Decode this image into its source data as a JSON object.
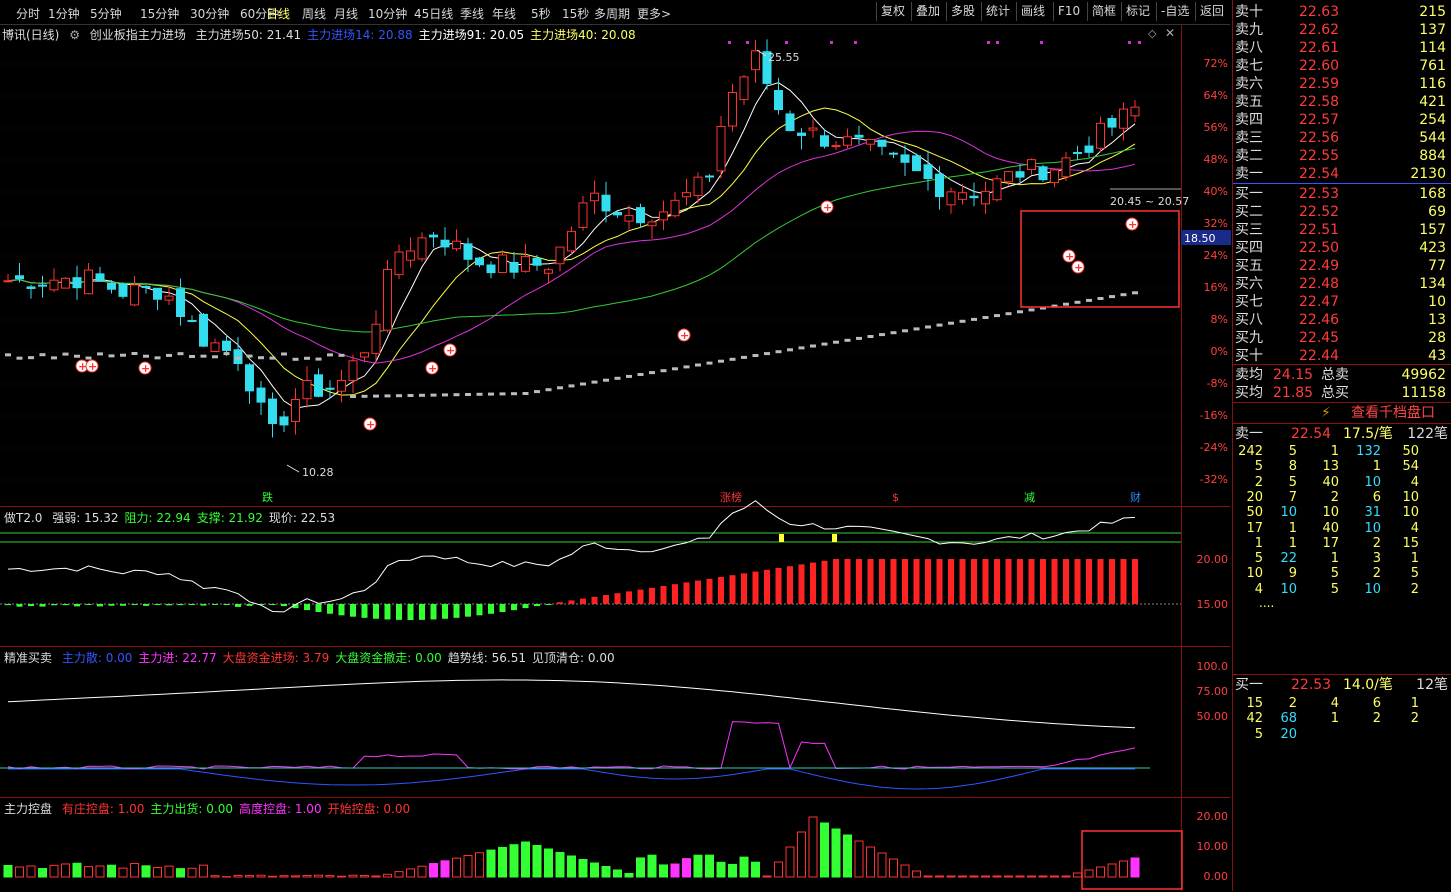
{
  "toolbar": {
    "periods": [
      "分时",
      "1分钟",
      "5分钟",
      "15分钟",
      "30分钟",
      "60分钟",
      "日线",
      "周线",
      "月线",
      "10分钟",
      "45日线",
      "季线",
      "年线",
      "5秒",
      "15秒",
      "多周期",
      "更多>"
    ],
    "active_period": "日线",
    "right_buttons": [
      "复权",
      "叠加",
      "多股",
      "统计",
      "画线",
      "F10",
      "简框",
      "标记",
      "-自选",
      "返回"
    ]
  },
  "main_panel": {
    "title": "博讯(日线)",
    "index_name": "创业板指",
    "indicator_name": "主力进场",
    "params": [
      {
        "label": "主力进场50: 21.41",
        "color": "#dddddd"
      },
      {
        "label": "主力进场14: 20.88",
        "color": "#3355ff"
      },
      {
        "label": "主力进场91: 20.05",
        "color": "#ffffff"
      },
      {
        "label": "主力进场40: 20.08",
        "color": "#ffff66"
      }
    ],
    "y_labels": [
      "72%",
      "64%",
      "56%",
      "48%",
      "40%",
      "32%",
      "24%",
      "16%",
      "8%",
      "0%",
      "-8%",
      "-16%",
      "-24%",
      "-32%"
    ],
    "high_label": "25.55",
    "low_label": "10.28",
    "current_price_tag": "18.50",
    "ma_label": "20.45 ~ 20.57",
    "markers": [
      {
        "text": "跌",
        "color": "#33ff33"
      },
      {
        "text": "涨榜",
        "color": "#ff3333"
      },
      {
        "text": "$",
        "color": "#ff3333"
      },
      {
        "text": "减",
        "color": "#33ff33"
      },
      {
        "text": "财",
        "color": "#3388ff"
      }
    ]
  },
  "panel2": {
    "name": "做T2.0",
    "params": [
      {
        "label": "强弱: 15.32",
        "color": "#dddddd"
      },
      {
        "label": "阻力: 22.94",
        "color": "#33ff33"
      },
      {
        "label": "支撑: 21.92",
        "color": "#33ff33"
      },
      {
        "label": "现价: 22.53",
        "color": "#dddddd"
      }
    ],
    "y_labels": [
      "20.00",
      "15.00"
    ]
  },
  "panel3": {
    "name": "精准买卖",
    "params": [
      {
        "label": "主力散: 0.00",
        "color": "#3355ff"
      },
      {
        "label": "主力进: 22.77",
        "color": "#ff33ff"
      },
      {
        "label": "大盘资金进场: 3.79",
        "color": "#ff3333"
      },
      {
        "label": "大盘资金撤走: 0.00",
        "color": "#33ff33"
      },
      {
        "label": "趋势线: 56.51",
        "color": "#dddddd"
      },
      {
        "label": "见顶清仓: 0.00",
        "color": "#dddddd"
      }
    ],
    "y_labels": [
      "100.0",
      "75.00",
      "50.00"
    ]
  },
  "panel4": {
    "name": "主力控盘",
    "params": [
      {
        "label": "有庄控盘: 1.00",
        "color": "#ff3333"
      },
      {
        "label": "主力出货: 0.00",
        "color": "#33ff33"
      },
      {
        "label": "高度控盘: 1.00",
        "color": "#ff33ff"
      },
      {
        "label": "开始控盘: 0.00",
        "color": "#ff3333"
      }
    ],
    "y_labels": [
      "20.00",
      "10.00",
      "0.00"
    ]
  },
  "order_book": {
    "asks": [
      {
        "label": "卖十",
        "price": "22.63",
        "vol": "215"
      },
      {
        "label": "卖九",
        "price": "22.62",
        "vol": "137"
      },
      {
        "label": "卖八",
        "price": "22.61",
        "vol": "114"
      },
      {
        "label": "卖七",
        "price": "22.60",
        "vol": "761"
      },
      {
        "label": "卖六",
        "price": "22.59",
        "vol": "116"
      },
      {
        "label": "卖五",
        "price": "22.58",
        "vol": "421"
      },
      {
        "label": "卖四",
        "price": "22.57",
        "vol": "254"
      },
      {
        "label": "卖三",
        "price": "22.56",
        "vol": "544"
      },
      {
        "label": "卖二",
        "price": "22.55",
        "vol": "884"
      },
      {
        "label": "卖一",
        "price": "22.54",
        "vol": "2130"
      }
    ],
    "bids": [
      {
        "label": "买一",
        "price": "22.53",
        "vol": "168"
      },
      {
        "label": "买二",
        "price": "22.52",
        "vol": "69"
      },
      {
        "label": "买三",
        "price": "22.51",
        "vol": "157"
      },
      {
        "label": "买四",
        "price": "22.50",
        "vol": "423"
      },
      {
        "label": "买五",
        "price": "22.49",
        "vol": "77"
      },
      {
        "label": "买六",
        "price": "22.48",
        "vol": "134"
      },
      {
        "label": "买七",
        "price": "22.47",
        "vol": "10"
      },
      {
        "label": "买八",
        "price": "22.46",
        "vol": "13"
      },
      {
        "label": "买九",
        "price": "22.45",
        "vol": "28"
      },
      {
        "label": "买十",
        "price": "22.44",
        "vol": "43"
      }
    ],
    "avg_sell_label": "卖均",
    "avg_sell": "24.15",
    "total_sell_label": "总卖",
    "total_sell": "49962",
    "avg_buy_label": "买均",
    "avg_buy": "21.85",
    "total_buy_label": "总买",
    "total_buy": "11158",
    "view_button": "查看千档盘口",
    "sell1_header": {
      "label": "卖一",
      "price": "22.54",
      "per": "17.5/笔",
      "count": "122笔"
    },
    "sell1_queue": [
      [
        "242",
        "5",
        "1",
        "132",
        "50"
      ],
      [
        "5",
        "8",
        "13",
        "1",
        "54"
      ],
      [
        "2",
        "5",
        "40",
        "10",
        "4"
      ],
      [
        "20",
        "7",
        "2",
        "6",
        "10"
      ],
      [
        "50",
        "10",
        "10",
        "31",
        "10"
      ],
      [
        "17",
        "1",
        "40",
        "10",
        "4"
      ],
      [
        "1",
        "1",
        "17",
        "2",
        "15"
      ],
      [
        "5",
        "22",
        "1",
        "3",
        "1"
      ],
      [
        "10",
        "9",
        "5",
        "2",
        "5"
      ],
      [
        "4",
        "10",
        "5",
        "10",
        "2"
      ]
    ],
    "more": "....",
    "buy1_header": {
      "label": "买一",
      "price": "22.53",
      "per": "14.0/笔",
      "count": "12笔"
    },
    "buy1_queue": [
      [
        "15",
        "2",
        "4",
        "6",
        "1"
      ],
      [
        "42",
        "68",
        "1",
        "2",
        "2"
      ],
      [
        "5",
        "20",
        "",
        "",
        ""
      ]
    ]
  }
}
